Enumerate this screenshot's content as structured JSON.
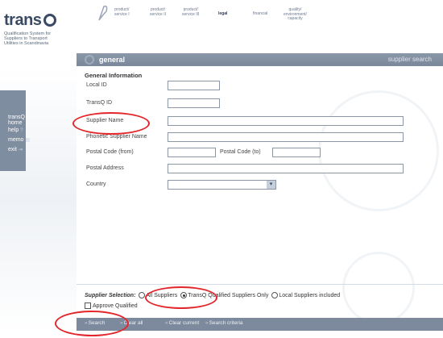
{
  "logo": {
    "word": "trans",
    "tagline": "Qualification System for\nSuppliers to Transport\nUtilities in Scandinavia"
  },
  "nav": [
    {
      "label": "product/\nservice I",
      "active": true
    },
    {
      "label": "product/\nservice II",
      "active": false
    },
    {
      "label": "product/\nservice III",
      "active": false
    },
    {
      "label": "legal",
      "active": true
    },
    {
      "label": "financial",
      "active": false
    },
    {
      "label": "quality/\nenvironment/\ncapacity",
      "active": false
    }
  ],
  "tabbar": {
    "title": "general",
    "right": "supplier search"
  },
  "sidebar": [
    {
      "label": "transQ\nhome",
      "icon": "home-icon"
    },
    {
      "label": "help",
      "icon": "help-icon"
    },
    {
      "label": "memo",
      "icon": "memo-icon"
    },
    {
      "label": "exit",
      "icon": "exit-icon"
    }
  ],
  "form": {
    "section_title": "General Information",
    "local_id_label": "Local ID",
    "transq_id_label": "TransQ ID",
    "supplier_name_label": "Supplier Name",
    "phonetic_name_label": "Phonetic Supplier Name",
    "postal_from_label": "Postal Code (from)",
    "postal_to_label": "Postal Code (to)",
    "postal_address_label": "Postal Address",
    "country_label": "Country",
    "country_value": ""
  },
  "selection": {
    "label": "Supplier Selection:",
    "options": [
      {
        "label": "All Suppliers",
        "selected": false
      },
      {
        "label": "TransQ Qualified Suppliers Only",
        "selected": true
      },
      {
        "label": "Local Suppliers included",
        "selected": false
      }
    ],
    "approve_label": "Approve Qualified"
  },
  "buttons": {
    "search": "Search",
    "clear_all": "Clear all",
    "clear_current": "Clear current",
    "search_criteria": "Search criteria"
  },
  "colors": {
    "accent": "#7d8a9d",
    "annotation": "#e3262b"
  }
}
